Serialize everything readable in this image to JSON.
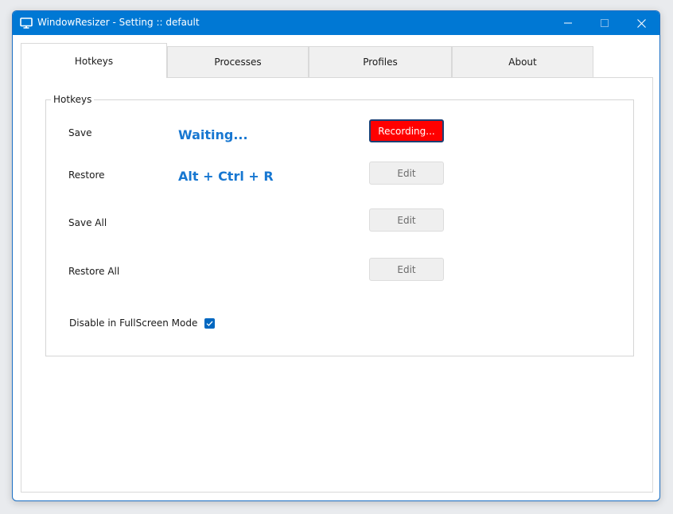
{
  "window": {
    "title": "WindowResizer - Setting  ::  default",
    "icon": "monitor-icon",
    "accent_color": "#0078d4"
  },
  "tabs": [
    {
      "label": "Hotkeys",
      "active": true
    },
    {
      "label": "Processes",
      "active": false
    },
    {
      "label": "Profiles",
      "active": false
    },
    {
      "label": "About",
      "active": false
    }
  ],
  "hotkeys": {
    "group_title": "Hotkeys",
    "rows": [
      {
        "label": "Save",
        "value": "Waiting...",
        "button": "Recording...",
        "recording": true
      },
      {
        "label": "Restore",
        "value": "Alt + Ctrl + R",
        "button": "Edit",
        "recording": false
      },
      {
        "label": "Save All",
        "value": "",
        "button": "Edit",
        "recording": false
      },
      {
        "label": "Restore All",
        "value": "",
        "button": "Edit",
        "recording": false
      }
    ],
    "disable_fullscreen": {
      "label": "Disable in FullScreen Mode",
      "checked": true
    },
    "value_color": "#1777d1",
    "recording_color": "#ff0000"
  }
}
